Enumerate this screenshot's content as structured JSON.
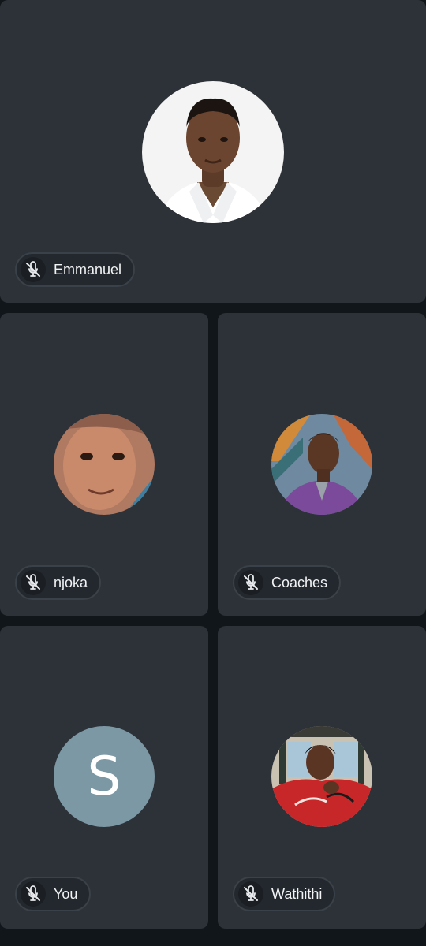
{
  "participants": [
    {
      "name": "Emmanuel",
      "muted": true,
      "avatar_type": "photo"
    },
    {
      "name": "njoka",
      "muted": true,
      "avatar_type": "photo"
    },
    {
      "name": "Coaches",
      "muted": true,
      "avatar_type": "photo"
    },
    {
      "name": "You",
      "muted": true,
      "avatar_type": "letter",
      "initial": "S",
      "avatar_color": "#7d98a5"
    },
    {
      "name": "Wathithi",
      "muted": true,
      "avatar_type": "photo"
    }
  ],
  "icons": {
    "mic": "mic-off-icon"
  },
  "colors": {
    "background": "#11161b",
    "tile": "#2d3238",
    "pill": "#23282e",
    "text": "#f1f3f4"
  }
}
